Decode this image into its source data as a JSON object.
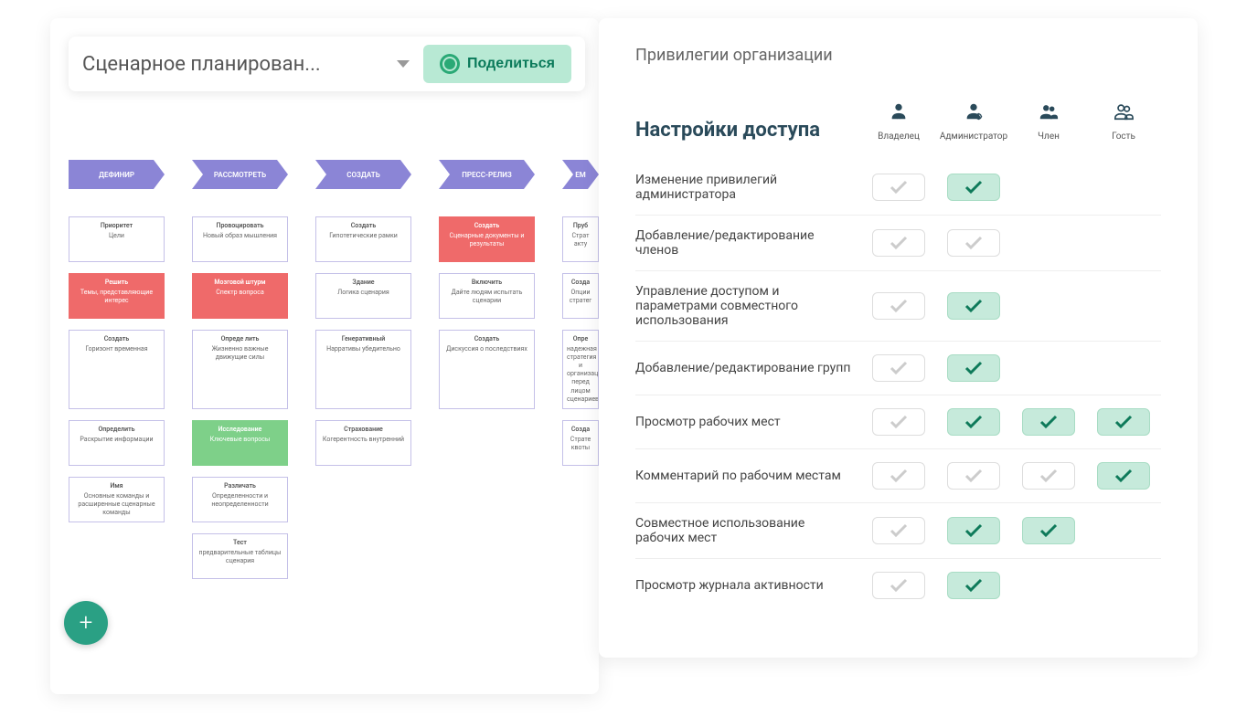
{
  "header": {
    "title": "Сценарное планирован...",
    "share_label": "Поделиться"
  },
  "board": {
    "columns": [
      "ДЕФИНИР",
      "РАССМОТРЕТЬ",
      "СОЗДАТЬ",
      "ПРЕСС-РЕЛИЗ",
      "ЕМ"
    ],
    "rows": [
      [
        {
          "t": "Приоритет",
          "d": "Цели"
        },
        {
          "t": "Провоцировать",
          "d": "Новый образ мышления"
        },
        {
          "t": "Создать",
          "d": "Гипотетические рамки"
        },
        {
          "t": "Создать",
          "d": "Сценарные документы и результаты",
          "c": "red"
        },
        {
          "t": "Пруб",
          "d": "Страт акту"
        }
      ],
      [
        {
          "t": "Решить",
          "d": "Темы, представляющие интерес",
          "c": "red"
        },
        {
          "t": "Мозговой штурм",
          "d": "Спектр вопроса",
          "c": "red"
        },
        {
          "t": "Здание",
          "d": "Логика сценария"
        },
        {
          "t": "Включить",
          "d": "Дайте людям испытать сценарии"
        },
        {
          "t": "Созда",
          "d": "Опции стратег"
        }
      ],
      [
        {
          "t": "Создать",
          "d": "Горизонт временная"
        },
        {
          "t": "Опреде лить",
          "d": "Жизненно важные движущие силы"
        },
        {
          "t": "Генеративный",
          "d": "Нарративы убедительно"
        },
        {
          "t": "Создать",
          "d": "Дискуссия о последствиях"
        },
        {
          "t": "Опре",
          "d": "надежная стратегия и организация перед лицом сценариев"
        }
      ],
      [
        {
          "t": "Определить",
          "d": "Раскрытие информации"
        },
        {
          "t": "Исследование",
          "d": "Ключевые вопросы",
          "c": "green"
        },
        {
          "t": "Страхование",
          "d": "Когерентность внутренний"
        },
        null,
        {
          "t": "Созда",
          "d": "Страте квоты"
        }
      ],
      [
        {
          "t": "Имя",
          "d": "Основные команды и расширенные сценарные команды"
        },
        {
          "t": "Различать",
          "d": "Определенности и неопределенности"
        },
        null,
        null,
        null
      ],
      [
        null,
        {
          "t": "Тест",
          "d": "предварительные таблицы сценария"
        },
        null,
        null,
        null
      ]
    ]
  },
  "privileges": {
    "page_title": "Привилегии организации",
    "section_title": "Настройки доступа",
    "roles": [
      {
        "label": "Владелец",
        "icon": "owner"
      },
      {
        "label": "Администратор",
        "icon": "admin"
      },
      {
        "label": "Член",
        "icon": "member"
      },
      {
        "label": "Гость",
        "icon": "guest"
      }
    ],
    "permissions": [
      {
        "label": "Изменение привилегий администратора",
        "vals": [
          "off",
          "on",
          null,
          null
        ]
      },
      {
        "label": "Добавление/редактирование членов",
        "vals": [
          "off",
          "off",
          null,
          null
        ]
      },
      {
        "label": "Управление доступом и параметрами совместного использования",
        "vals": [
          "off",
          "on",
          null,
          null
        ]
      },
      {
        "label": "Добавление/редактирование групп",
        "vals": [
          "off",
          "on",
          null,
          null
        ]
      },
      {
        "label": "Просмотр рабочих мест",
        "vals": [
          "off",
          "on",
          "on",
          "on"
        ]
      },
      {
        "label": "Комментарий по рабочим местам",
        "vals": [
          "off",
          "off",
          "off",
          "on"
        ]
      },
      {
        "label": "Совместное использование рабочих мест",
        "vals": [
          "off",
          "on",
          "on",
          null
        ]
      },
      {
        "label": "Просмотр журнала активности",
        "vals": [
          "off",
          "on",
          null,
          null
        ]
      }
    ]
  },
  "fab": "+"
}
